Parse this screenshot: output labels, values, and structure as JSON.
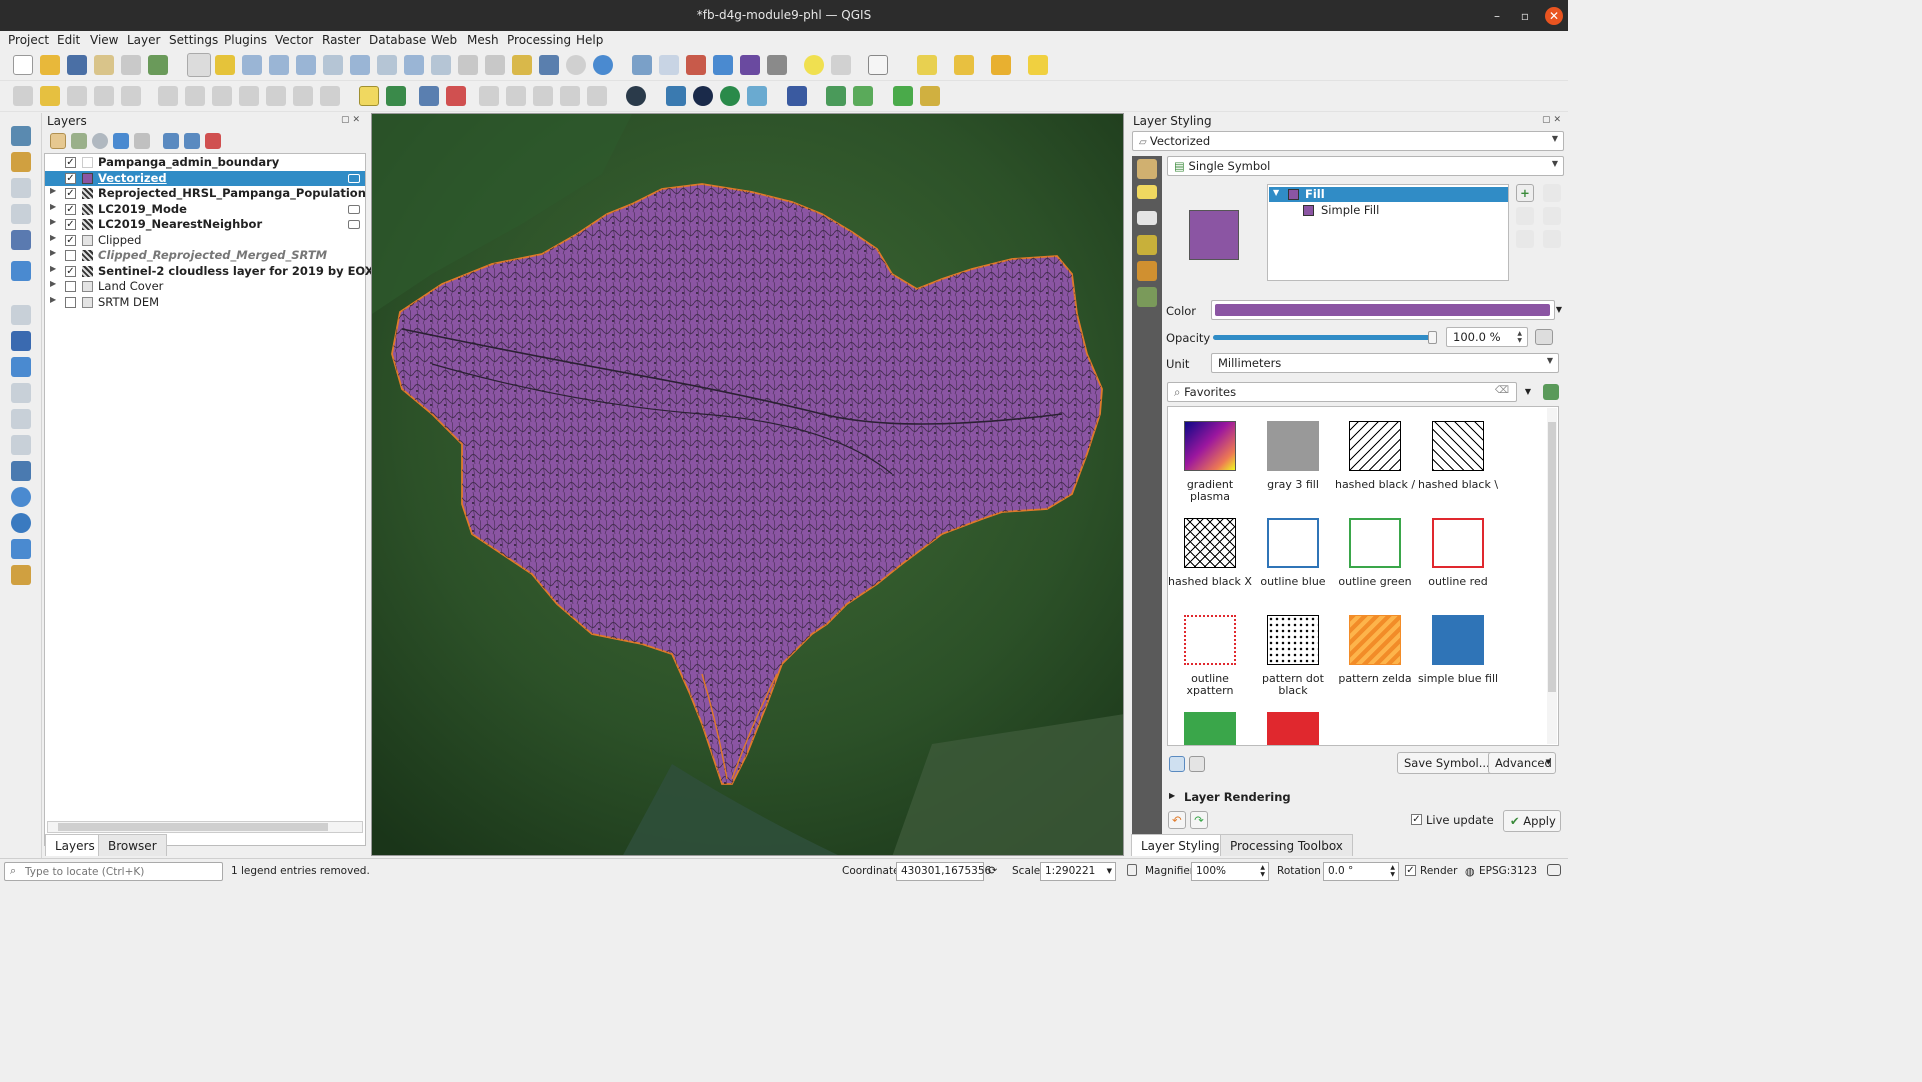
{
  "window": {
    "title": "*fb-d4g-module9-phl — QGIS"
  },
  "menu": [
    "Project",
    "Edit",
    "View",
    "Layer",
    "Settings",
    "Plugins",
    "Vector",
    "Raster",
    "Database",
    "Web",
    "Mesh",
    "Processing",
    "Help"
  ],
  "layers_panel": {
    "title": "Layers",
    "items": [
      {
        "name": "Pampanga_admin_boundary",
        "checked": true,
        "bold": true
      },
      {
        "name": "Vectorized",
        "checked": true,
        "bold": true,
        "selected": true
      },
      {
        "name": "Reprojected_HRSL_Pampanga_Population",
        "checked": true,
        "bold": true
      },
      {
        "name": "LC2019_Mode",
        "checked": true,
        "bold": true
      },
      {
        "name": "LC2019_NearestNeighbor",
        "checked": true,
        "bold": true
      },
      {
        "name": "Clipped",
        "checked": true,
        "bold": false
      },
      {
        "name": "Clipped_Reprojected_Merged_SRTM",
        "checked": false,
        "italic": true
      },
      {
        "name": "Sentinel-2 cloudless layer for 2019 by EOX - ",
        "checked": true,
        "bold": true
      },
      {
        "name": "Land Cover",
        "checked": false,
        "bold": false
      },
      {
        "name": "SRTM DEM",
        "checked": false,
        "bold": false
      }
    ],
    "tabs": [
      "Layers",
      "Browser"
    ]
  },
  "styling": {
    "title": "Layer Styling",
    "layer": "Vectorized",
    "renderer": "Single Symbol",
    "tree_fill": "Fill",
    "tree_simple_fill": "Simple Fill",
    "color_label": "Color",
    "opacity_label": "Opacity",
    "opacity_value": "100.0 %",
    "opacity_level": 1.0,
    "unit_label": "Unit",
    "unit_value": "Millimeters",
    "search_value": "Favorites",
    "symbols": [
      {
        "label": "gradient plasma"
      },
      {
        "label": "gray 3 fill"
      },
      {
        "label": "hashed black /"
      },
      {
        "label": "hashed black \\"
      },
      {
        "label": "hashed black X"
      },
      {
        "label": "outline blue"
      },
      {
        "label": "outline green"
      },
      {
        "label": "outline red"
      },
      {
        "label": "outline xpattern"
      },
      {
        "label": "pattern dot black"
      },
      {
        "label": "pattern zelda"
      },
      {
        "label": "simple blue fill"
      }
    ],
    "save_symbol": "Save Symbol...",
    "advanced": "Advanced",
    "layer_rendering": "Layer Rendering",
    "live_update": "Live update",
    "apply": "Apply",
    "tabs": [
      "Layer Styling",
      "Processing Toolbox"
    ]
  },
  "colors": {
    "fill": "#8b55a3",
    "outline": "#e07a2a",
    "selection": "#308cc6"
  },
  "status": {
    "locate_placeholder": "Type to locate (Ctrl+K)",
    "message": "1 legend entries removed.",
    "coordinate_label": "Coordinate",
    "coordinate": "430301,1675356",
    "scale_label": "Scale",
    "scale": "1:290221",
    "magnifier_label": "Magnifier",
    "magnifier": "100%",
    "rotation_label": "Rotation",
    "rotation": "0.0 °",
    "render_label": "Render",
    "crs": "EPSG:3123"
  }
}
